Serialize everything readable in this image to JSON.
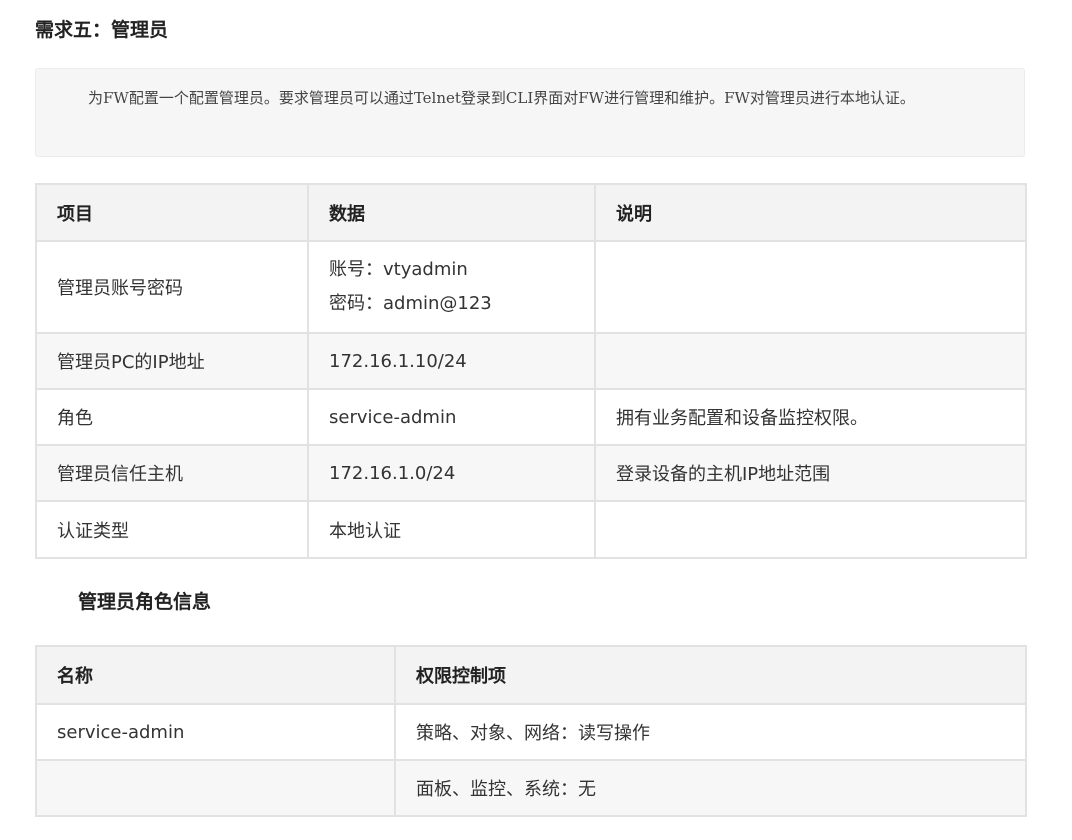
{
  "heading": "需求五：管理员",
  "note": {
    "text": "为FW配置一个配置管理员。要求管理员可以通过Telnet登录到CLI界面对FW进行管理和维护。FW对管理员进行本地认证。"
  },
  "table1": {
    "headers": [
      "项目",
      "数据",
      "说明"
    ],
    "rows": [
      {
        "item": "管理员账号密码",
        "data": [
          "账号：vtyadmin",
          "密码：admin@123"
        ],
        "desc": ""
      },
      {
        "item": "管理员PC的IP地址",
        "data": [
          "172.16.1.10/24"
        ],
        "desc": ""
      },
      {
        "item": "角色",
        "data": [
          "service-admin"
        ],
        "desc": "拥有业务配置和设备监控权限。"
      },
      {
        "item": "管理员信任主机",
        "data": [
          "172.16.1.0/24"
        ],
        "desc": "登录设备的主机IP地址范围"
      },
      {
        "item": "认证类型",
        "data": [
          "本地认证"
        ],
        "desc": ""
      }
    ]
  },
  "subheading": "管理员角色信息",
  "table2": {
    "headers": [
      "名称",
      "权限控制项"
    ],
    "rows": [
      {
        "name": "service-admin",
        "perm": "策略、对象、网络：读写操作"
      },
      {
        "name": "",
        "perm": "面板、监控、系统：无"
      }
    ]
  }
}
